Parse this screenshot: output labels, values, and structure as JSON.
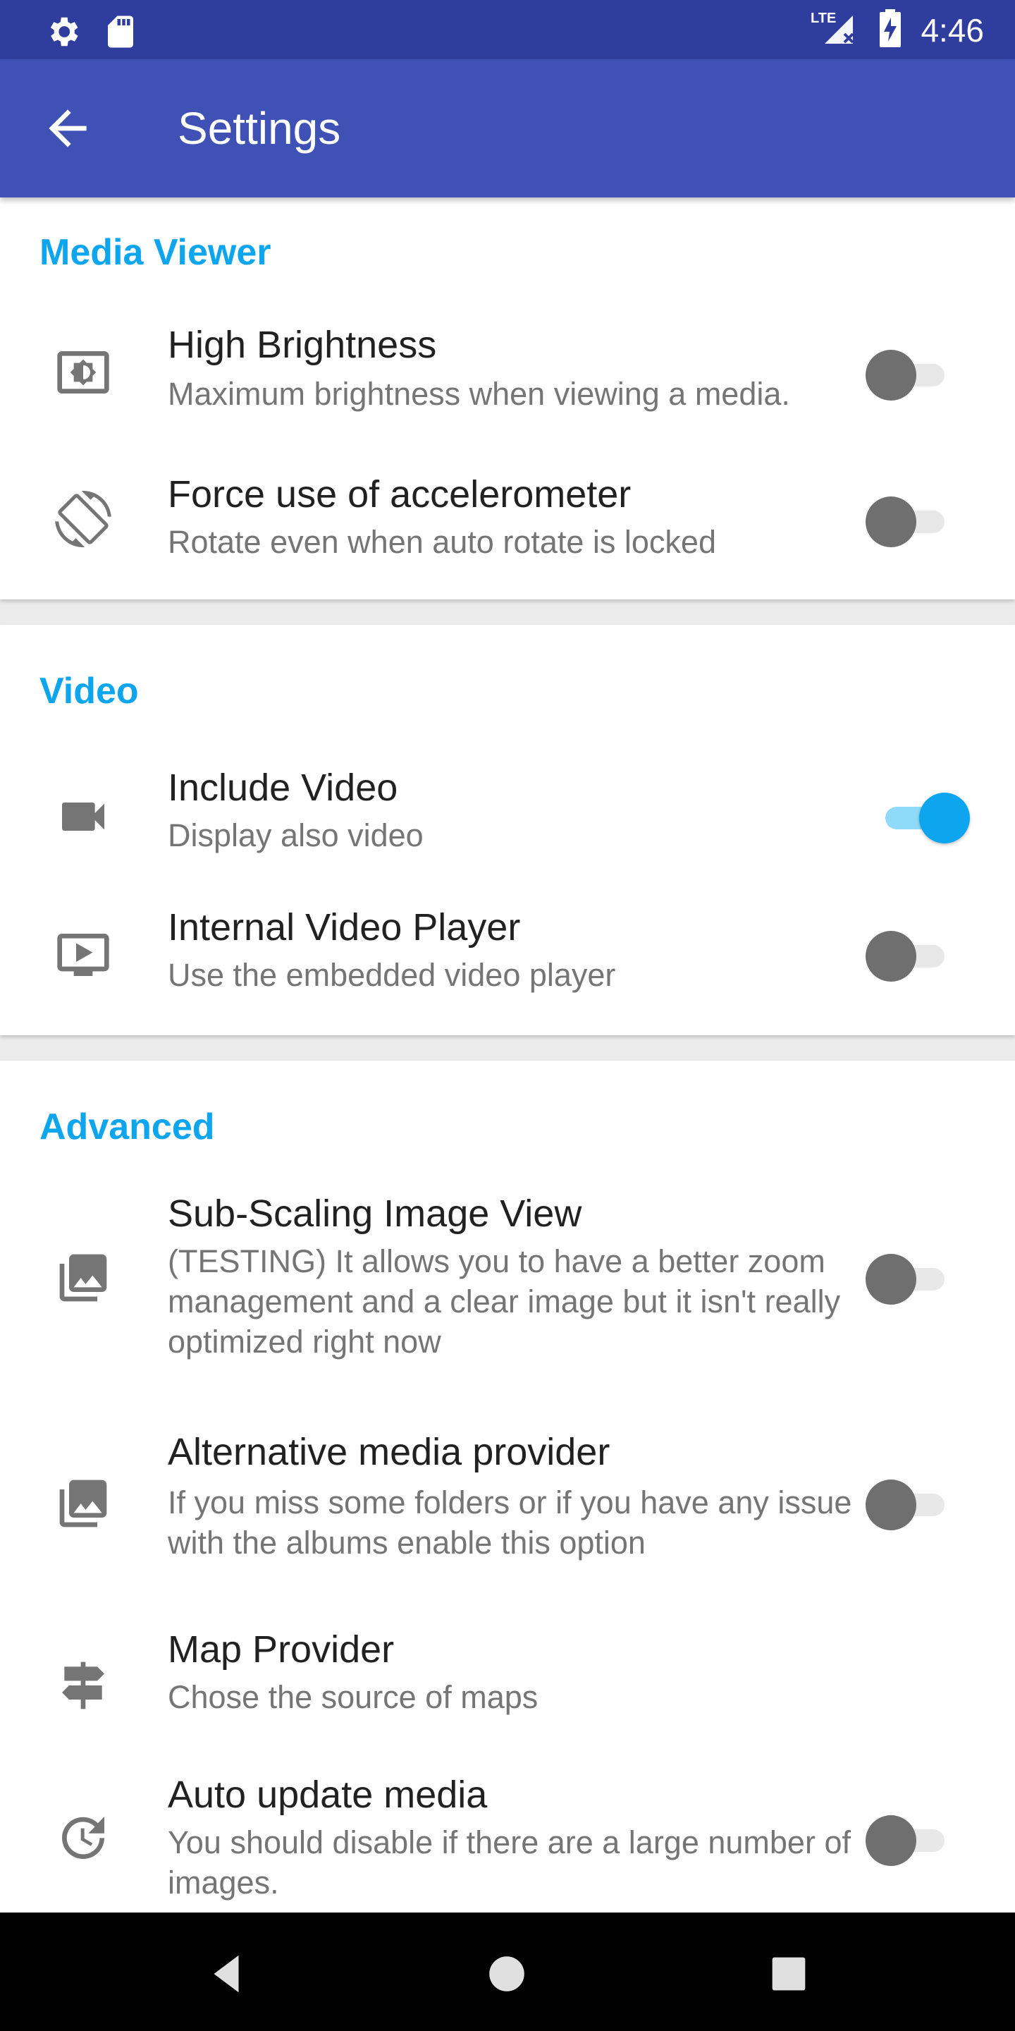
{
  "status_bar": {
    "time": "4:46",
    "network": "LTE",
    "icons": [
      "settings-icon",
      "sd-card-icon",
      "signal-icon",
      "battery-charging-icon"
    ]
  },
  "app_bar": {
    "title": "Settings",
    "back_icon": "arrow-back-icon"
  },
  "sections": {
    "media_viewer": {
      "title": "Media Viewer",
      "items": [
        {
          "title": "High Brightness",
          "summary": "Maximum brightness when viewing a media.",
          "icon": "brightness-icon",
          "toggle": false
        },
        {
          "title": "Force use of accelerometer",
          "summary": "Rotate even when auto rotate is locked",
          "icon": "screen-rotation-icon",
          "toggle": false
        }
      ]
    },
    "video": {
      "title": "Video",
      "items": [
        {
          "title": "Include Video",
          "summary": "Display also video",
          "icon": "videocam-icon",
          "toggle": true
        },
        {
          "title": "Internal Video Player",
          "summary": "Use the embedded video player",
          "icon": "video-player-icon",
          "toggle": false
        }
      ]
    },
    "advanced": {
      "title": "Advanced",
      "items": [
        {
          "title": "Sub-Scaling Image View",
          "summary": "(TESTING) It allows you to have a better zoom management and a clear image but it isn't really optimized right now",
          "icon": "photo-library-icon",
          "toggle": false
        },
        {
          "title": "Alternative media provider",
          "summary": "If you miss some folders or if you have any issue with the albums enable this option",
          "icon": "photo-library-icon",
          "toggle": false
        },
        {
          "title": "Map Provider",
          "summary": "Chose the source of maps",
          "icon": "signpost-icon",
          "toggle": null
        },
        {
          "title": "Auto update media",
          "summary": "You should disable if there are a large number of images.",
          "icon": "update-icon",
          "toggle": false
        }
      ]
    }
  },
  "nav_bar": {
    "icons": [
      "nav-back-icon",
      "nav-home-icon",
      "nav-recents-icon"
    ]
  },
  "colors": {
    "status_bar": "#2f3e9e",
    "app_bar": "#3f51b5",
    "accent": "#0ea5ef",
    "text_primary": "#212121",
    "text_secondary": "#757575",
    "background": "#ececec"
  }
}
